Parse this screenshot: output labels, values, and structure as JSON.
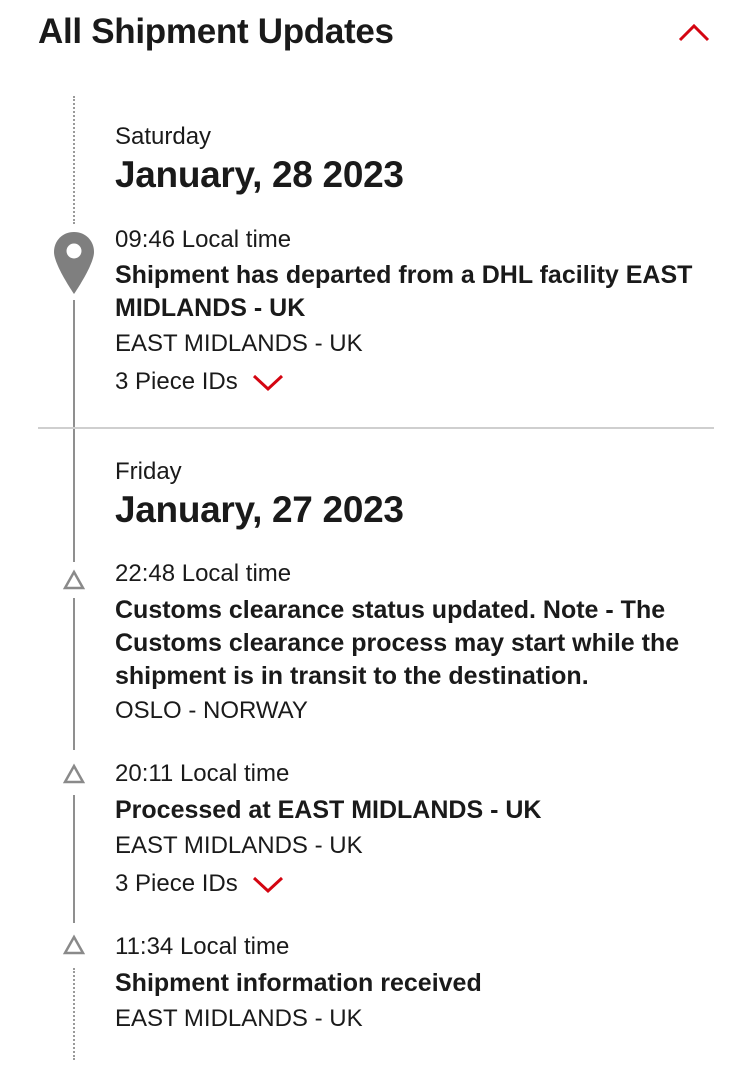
{
  "header": {
    "title": "All Shipment Updates",
    "collapse_icon": "chevron-up-icon",
    "accent_color": "#d40511"
  },
  "days": [
    {
      "weekday": "Saturday",
      "date": "January, 28 2023",
      "events": [
        {
          "time": "09:46 Local time",
          "description": "Shipment has departed from a DHL facility EAST MIDLANDS - UK",
          "location": "EAST MIDLANDS - UK",
          "piece_ids": "3 Piece IDs",
          "marker": "location-pin-icon"
        }
      ]
    },
    {
      "weekday": "Friday",
      "date": "January, 27 2023",
      "events": [
        {
          "time": "22:48 Local time",
          "description": "Customs clearance status updated. Note - The Customs clearance process may start while the shipment is in transit to the destination.",
          "location": "OSLO - NORWAY",
          "marker": "triangle-icon"
        },
        {
          "time": "20:11 Local time",
          "description": "Processed at EAST MIDLANDS - UK",
          "location": "EAST MIDLANDS - UK",
          "piece_ids": "3 Piece IDs",
          "marker": "triangle-icon"
        },
        {
          "time": "11:34 Local time",
          "description": "Shipment information received",
          "location": "EAST MIDLANDS - UK",
          "marker": "triangle-icon"
        }
      ]
    }
  ]
}
